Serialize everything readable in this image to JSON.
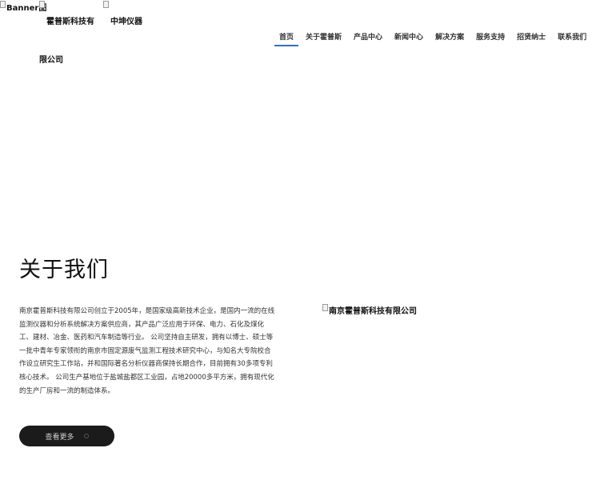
{
  "header": {
    "banner_alt": "Banner图",
    "company_name_line1": "霍普斯科技有",
    "company_name_line2": "限公司",
    "brand_name": "中坤仪器"
  },
  "nav": {
    "items": [
      {
        "label": "首页",
        "active": true
      },
      {
        "label": "关于霍普斯",
        "active": false
      },
      {
        "label": "产品中心",
        "active": false
      },
      {
        "label": "新闻中心",
        "active": false
      },
      {
        "label": "解决方案",
        "active": false
      },
      {
        "label": "服务支持",
        "active": false
      },
      {
        "label": "招贤纳士",
        "active": false
      },
      {
        "label": "联系我们",
        "active": false
      }
    ],
    "active_color": "#2f6fe0"
  },
  "about": {
    "title": "关于我们",
    "body": "南京霍普斯科技有限公司创立于2005年，是国家级高新技术企业，是国内一流的在线监测仪器和分析系统解决方案供应商，其产品广泛应用于环保、电力、石化及煤化工、建材、冶金、医药和汽车制造等行业。 公司坚持自主研发，拥有以博士、硕士等一批中青年专家领衔的南京市固定源废气监测工程技术研究中心，与知名大专院校合作设立研究生工作站，并和国际著名分析仪器商保持长期合作，目前拥有30多项专利核心技术。 公司生产基地位于盐城盐都区工业园，占地20000多平方米，拥有现代化的生产厂房和一流的制造体系。",
    "photo_alt": "南京霍普斯科技有限公司",
    "more_label": "查看更多"
  }
}
